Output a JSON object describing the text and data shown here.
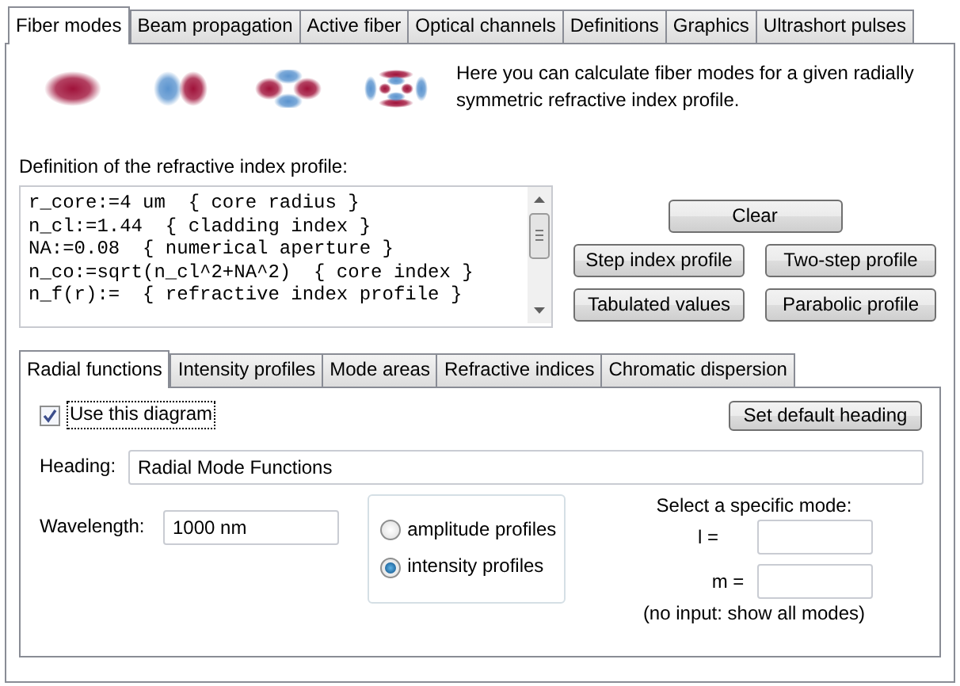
{
  "tabs": [
    {
      "label": "Fiber modes",
      "selected": true
    },
    {
      "label": "Beam propagation",
      "selected": false
    },
    {
      "label": "Active fiber",
      "selected": false
    },
    {
      "label": "Optical channels",
      "selected": false
    },
    {
      "label": "Definitions",
      "selected": false
    },
    {
      "label": "Graphics",
      "selected": false
    },
    {
      "label": "Ultrashort pulses",
      "selected": false
    }
  ],
  "description": "Here you can calculate fiber modes for a given radially symmetric refractive index profile.",
  "profile_definition": {
    "label": "Definition of the refractive index profile:",
    "lines": [
      "r_core:=4 um  { core radius }",
      "n_cl:=1.44  { cladding index }",
      "NA:=0.08  { numerical aperture }",
      "n_co:=sqrt(n_cl^2+NA^2)  { core index }",
      "n_f(r):=  { refractive index profile }"
    ]
  },
  "buttons": [
    "Clear",
    "Step index profile",
    "Two-step profile",
    "Tabulated values",
    "Parabolic profile"
  ],
  "sub_tabs": [
    {
      "label": "Radial functions",
      "selected": true
    },
    {
      "label": "Intensity profiles",
      "selected": false
    },
    {
      "label": "Mode areas",
      "selected": false
    },
    {
      "label": "Refractive indices",
      "selected": false
    },
    {
      "label": "Chromatic dispersion",
      "selected": false
    }
  ],
  "use_diagram": {
    "label": "Use this diagram",
    "checked": true
  },
  "set_default_heading_button": "Set default heading",
  "heading": {
    "label": "Heading:",
    "value": "Radial Mode Functions"
  },
  "wavelength": {
    "label": "Wavelength:",
    "value": "1000 nm"
  },
  "profile_type": [
    {
      "label": "amplitude profiles",
      "selected": false
    },
    {
      "label": "intensity profiles",
      "selected": true
    }
  ],
  "mode_selection": {
    "title": "Select a specific mode:",
    "l_label": "l =",
    "m_label": "m =",
    "note": "(no input: show all modes)"
  }
}
